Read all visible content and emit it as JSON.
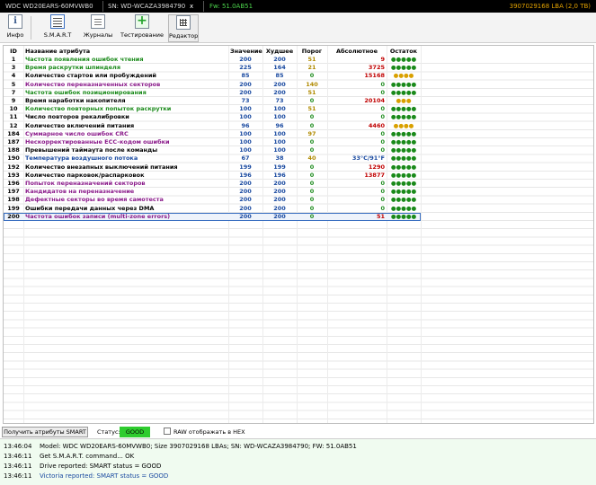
{
  "topbar": {
    "model": "WDC WD20EARS-60MVWB0",
    "serial": "SN: WD-WCAZA3984790",
    "close": "x",
    "firmware": "Fw: 51.0AB51",
    "lba": "3907029168 LBA (2,0 TB)"
  },
  "toolbar": {
    "items": [
      {
        "label": "Инфо",
        "icon": "info-icon"
      },
      {
        "label": "S.M.A.R.T",
        "icon": "smart-icon"
      },
      {
        "label": "Журналы",
        "icon": "log-icon"
      },
      {
        "label": "Тестирование",
        "icon": "test-icon"
      },
      {
        "label": "Редактор",
        "icon": "editor-icon"
      }
    ]
  },
  "table": {
    "headers": [
      "ID",
      "Название атрибута",
      "Значение",
      "Худшее",
      "Порог",
      "Абсолютное",
      "Остаток"
    ],
    "rows": [
      {
        "id": "1",
        "name": "Частота появления ошибок чтения",
        "value": "200",
        "worst": "200",
        "threshold": "51",
        "raw": "9",
        "health": "●●●●●",
        "name_color": "#1a8a1a",
        "th_color": "#b08a00",
        "raw_color": "#c00000",
        "health_color": "#1a8a1a"
      },
      {
        "id": "3",
        "name": "Время раскрутки шпинделя",
        "value": "225",
        "worst": "164",
        "threshold": "21",
        "raw": "3725",
        "health": "●●●●●",
        "name_color": "#1a8a1a",
        "th_color": "#b08a00",
        "raw_color": "#c00000",
        "health_color": "#1a8a1a"
      },
      {
        "id": "4",
        "name": "Количество стартов или пробуждений",
        "value": "85",
        "worst": "85",
        "threshold": "0",
        "raw": "15168",
        "health": "●●●●",
        "name_color": "#000000",
        "th_color": "#1a8a1a",
        "raw_color": "#c00000",
        "health_color": "#d9a000"
      },
      {
        "id": "5",
        "name": "Количество переназначенных секторов",
        "value": "200",
        "worst": "200",
        "threshold": "140",
        "raw": "0",
        "health": "●●●●●",
        "name_color": "#8a1a8a",
        "th_color": "#b08a00",
        "raw_color": "#1a8a1a",
        "health_color": "#1a8a1a"
      },
      {
        "id": "7",
        "name": "Частота ошибок позиционирования",
        "value": "200",
        "worst": "200",
        "threshold": "51",
        "raw": "0",
        "health": "●●●●●",
        "name_color": "#1a8a1a",
        "th_color": "#b08a00",
        "raw_color": "#1a8a1a",
        "health_color": "#1a8a1a"
      },
      {
        "id": "9",
        "name": "Время наработки накопителя",
        "value": "73",
        "worst": "73",
        "threshold": "0",
        "raw": "20104",
        "health": "●●●",
        "name_color": "#000000",
        "th_color": "#1a8a1a",
        "raw_color": "#c00000",
        "health_color": "#d9a000"
      },
      {
        "id": "10",
        "name": "Количество повторных попыток раскрутки",
        "value": "100",
        "worst": "100",
        "threshold": "51",
        "raw": "0",
        "health": "●●●●●",
        "name_color": "#1a8a1a",
        "th_color": "#b08a00",
        "raw_color": "#1a8a1a",
        "health_color": "#1a8a1a"
      },
      {
        "id": "11",
        "name": "Число повторов рекалибровки",
        "value": "100",
        "worst": "100",
        "threshold": "0",
        "raw": "0",
        "health": "●●●●●",
        "name_color": "#000000",
        "th_color": "#1a8a1a",
        "raw_color": "#1a8a1a",
        "health_color": "#1a8a1a"
      },
      {
        "id": "12",
        "name": "Количество включений питания",
        "value": "96",
        "worst": "96",
        "threshold": "0",
        "raw": "4460",
        "health": "●●●●",
        "name_color": "#000000",
        "th_color": "#1a8a1a",
        "raw_color": "#c00000",
        "health_color": "#d9a000"
      },
      {
        "id": "184",
        "name": "Суммарное число ошибок CRC",
        "value": "100",
        "worst": "100",
        "threshold": "97",
        "raw": "0",
        "health": "●●●●●",
        "name_color": "#8a1a8a",
        "th_color": "#b08a00",
        "raw_color": "#1a8a1a",
        "health_color": "#1a8a1a"
      },
      {
        "id": "187",
        "name": "Нескорректированные ECC-кодом ошибки",
        "value": "100",
        "worst": "100",
        "threshold": "0",
        "raw": "0",
        "health": "●●●●●",
        "name_color": "#8a1a8a",
        "th_color": "#1a8a1a",
        "raw_color": "#1a8a1a",
        "health_color": "#1a8a1a"
      },
      {
        "id": "188",
        "name": "Превышений таймаута после команды",
        "value": "100",
        "worst": "100",
        "threshold": "0",
        "raw": "0",
        "health": "●●●●●",
        "name_color": "#000000",
        "th_color": "#1a8a1a",
        "raw_color": "#1a8a1a",
        "health_color": "#1a8a1a"
      },
      {
        "id": "190",
        "name": "Температура воздушного потока",
        "value": "67",
        "worst": "38",
        "threshold": "40",
        "raw": "33°C/91°F",
        "health": "●●●●●",
        "name_color": "#1a4aa0",
        "th_color": "#b08a00",
        "raw_color": "#1a4aa0",
        "health_color": "#1a8a1a"
      },
      {
        "id": "192",
        "name": "Количество внезапных выключений питания",
        "value": "199",
        "worst": "199",
        "threshold": "0",
        "raw": "1290",
        "health": "●●●●●",
        "name_color": "#000000",
        "th_color": "#1a8a1a",
        "raw_color": "#c00000",
        "health_color": "#1a8a1a"
      },
      {
        "id": "193",
        "name": "Количество парковок/распарковок",
        "value": "196",
        "worst": "196",
        "threshold": "0",
        "raw": "13877",
        "health": "●●●●●",
        "name_color": "#000000",
        "th_color": "#1a8a1a",
        "raw_color": "#c00000",
        "health_color": "#1a8a1a"
      },
      {
        "id": "196",
        "name": "Попыток переназначений секторов",
        "value": "200",
        "worst": "200",
        "threshold": "0",
        "raw": "0",
        "health": "●●●●●",
        "name_color": "#8a1a8a",
        "th_color": "#1a8a1a",
        "raw_color": "#1a8a1a",
        "health_color": "#1a8a1a"
      },
      {
        "id": "197",
        "name": "Кандидатов на переназначение",
        "value": "200",
        "worst": "200",
        "threshold": "0",
        "raw": "0",
        "health": "●●●●●",
        "name_color": "#8a1a8a",
        "th_color": "#1a8a1a",
        "raw_color": "#1a8a1a",
        "health_color": "#1a8a1a"
      },
      {
        "id": "198",
        "name": "Дефектные секторы во время самотеста",
        "value": "200",
        "worst": "200",
        "threshold": "0",
        "raw": "0",
        "health": "●●●●●",
        "name_color": "#8a1a8a",
        "th_color": "#1a8a1a",
        "raw_color": "#1a8a1a",
        "health_color": "#1a8a1a"
      },
      {
        "id": "199",
        "name": "Ошибки передачи данных через DMA",
        "value": "200",
        "worst": "200",
        "threshold": "0",
        "raw": "0",
        "health": "●●●●●",
        "name_color": "#000000",
        "th_color": "#1a8a1a",
        "raw_color": "#1a8a1a",
        "health_color": "#1a8a1a"
      },
      {
        "id": "200",
        "name": "Частота ошибок записи (multi-zone errors)",
        "value": "200",
        "worst": "200",
        "threshold": "0",
        "raw": "51",
        "health": "●●●●●",
        "name_color": "#8a1a8a",
        "th_color": "#1a8a1a",
        "raw_color": "#c00000",
        "health_color": "#1a8a1a"
      }
    ]
  },
  "bottom": {
    "button": "Получить атрибуты SMART",
    "status_label": "Статус:",
    "status_value": "GOOD",
    "status_color": "#2ecc2e",
    "checkbox_label": "RAW отображать в HEX"
  },
  "log": [
    {
      "time": "13:46:04",
      "text": "Model: WDC WD20EARS-60MVWB0; Size 3907029168 LBAs; SN: WD-WCAZA3984790; FW: 51.0AB51",
      "color": "#000000"
    },
    {
      "time": "13:46:11",
      "text": "Get S.M.A.R.T. command... OK",
      "color": "#000000"
    },
    {
      "time": "13:46:11",
      "text": "Drive reported: SMART status = GOOD",
      "color": "#000000"
    },
    {
      "time": "13:46:11",
      "text": "Victoria reported: SMART status = GOOD",
      "color": "#1a4aa0"
    }
  ],
  "colors": {
    "value": "#1a4aa0",
    "worst": "#1a4aa0",
    "log_bg": "#f0fbf0"
  }
}
